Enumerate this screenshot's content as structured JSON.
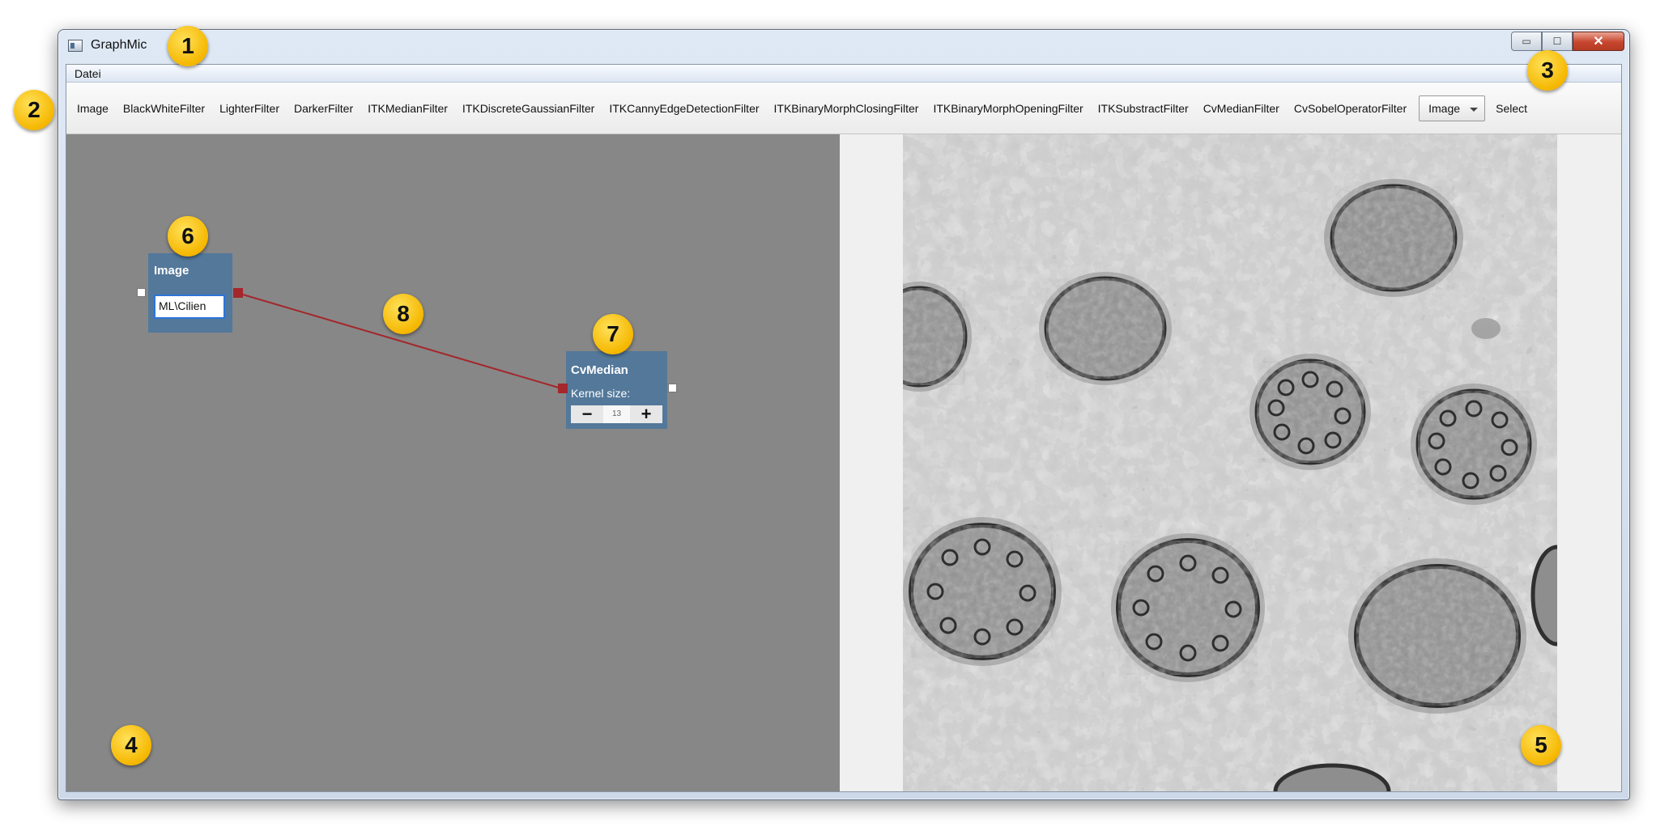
{
  "window": {
    "title": "GraphMic"
  },
  "menu": {
    "items": [
      "Datei"
    ]
  },
  "toolbar": {
    "items": [
      "Image",
      "BlackWhiteFilter",
      "LighterFilter",
      "DarkerFilter",
      "ITKMedianFilter",
      "ITKDiscreteGaussianFilter",
      "ITKCannyEdgeDetectionFilter",
      "ITKBinaryMorphClosingFilter",
      "ITKBinaryMorphOpeningFilter",
      "ITKSubstractFilter",
      "CvMedianFilter",
      "CvSobelOperatorFilter"
    ],
    "combo_value": "Image",
    "select_label": "Select"
  },
  "graph": {
    "image_node": {
      "title": "Image",
      "path_value": "ML\\Cilien"
    },
    "median_node": {
      "title": "CvMedian",
      "kernel_label": "Kernel size:",
      "minus": "−",
      "plus": "+",
      "kernel_value": "13"
    }
  },
  "markers": [
    "1",
    "2",
    "3",
    "4",
    "5",
    "6",
    "7",
    "8"
  ],
  "icons": {
    "app": "app-window-icon",
    "minimize": "minimize-icon",
    "maximize": "maximize-icon",
    "close": "close-icon",
    "dropdown": "chevron-down-icon"
  },
  "colors": {
    "graph_background": "#878787",
    "node_fill": "#53789a",
    "edge": "#a4272c",
    "marker": "#f5b700"
  }
}
